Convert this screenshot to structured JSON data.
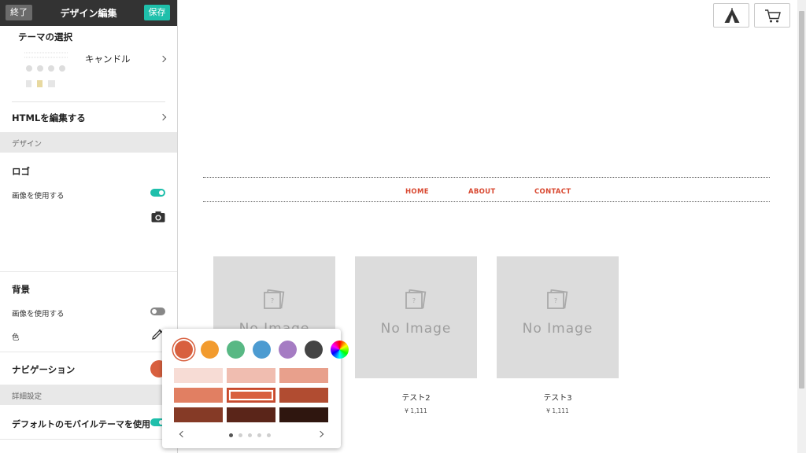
{
  "topbar": {
    "exit_label": "終了",
    "title": "デザイン編集",
    "save_label": "保存"
  },
  "theme": {
    "section_label": "テーマの選択",
    "theme_name": "キャンドル"
  },
  "html_edit": {
    "label": "HTMLを編集する"
  },
  "design_band": {
    "label": "デザイン"
  },
  "logo": {
    "title": "ロゴ",
    "use_image_label": "画像を使用する",
    "use_image_on": true
  },
  "background": {
    "title": "背景",
    "use_image_label": "画像を使用する",
    "use_image_on": false,
    "color_label": "色"
  },
  "navigation": {
    "label": "ナビゲーション",
    "color": "#d8603f"
  },
  "advanced_band": {
    "label": "詳細設定"
  },
  "mobile_theme": {
    "label": "デフォルトのモバイルテーマを使用",
    "on": true
  },
  "nav_links": [
    "HOME",
    "ABOUT",
    "CONTACT"
  ],
  "products": [
    {
      "name": "",
      "price": "",
      "image_text": "No Image"
    },
    {
      "name": "テスト2",
      "price": "¥ 1,111",
      "image_text": "No Image"
    },
    {
      "name": "テスト3",
      "price": "¥ 1,111",
      "image_text": "No Image"
    }
  ],
  "header_icons": [
    "tent-icon",
    "cart-icon"
  ],
  "color_picker": {
    "base_colors": [
      "#d8603f",
      "#f29b2e",
      "#58b884",
      "#4c9bd1",
      "#a57cc3",
      "#444444",
      "rainbow"
    ],
    "selected_base": 0,
    "shades": [
      "#f7dcd5",
      "#f0bdb0",
      "#e8a08c",
      "#e17f62",
      "#d8603f",
      "#b14c31",
      "#853a26",
      "#5a2519",
      "#2f160f"
    ],
    "selected_shade": 4,
    "pages": 5,
    "current_page": 0
  },
  "colors": {
    "accent": "#1fbfab",
    "nav_text": "#d8472f",
    "topbar": "#333333"
  }
}
